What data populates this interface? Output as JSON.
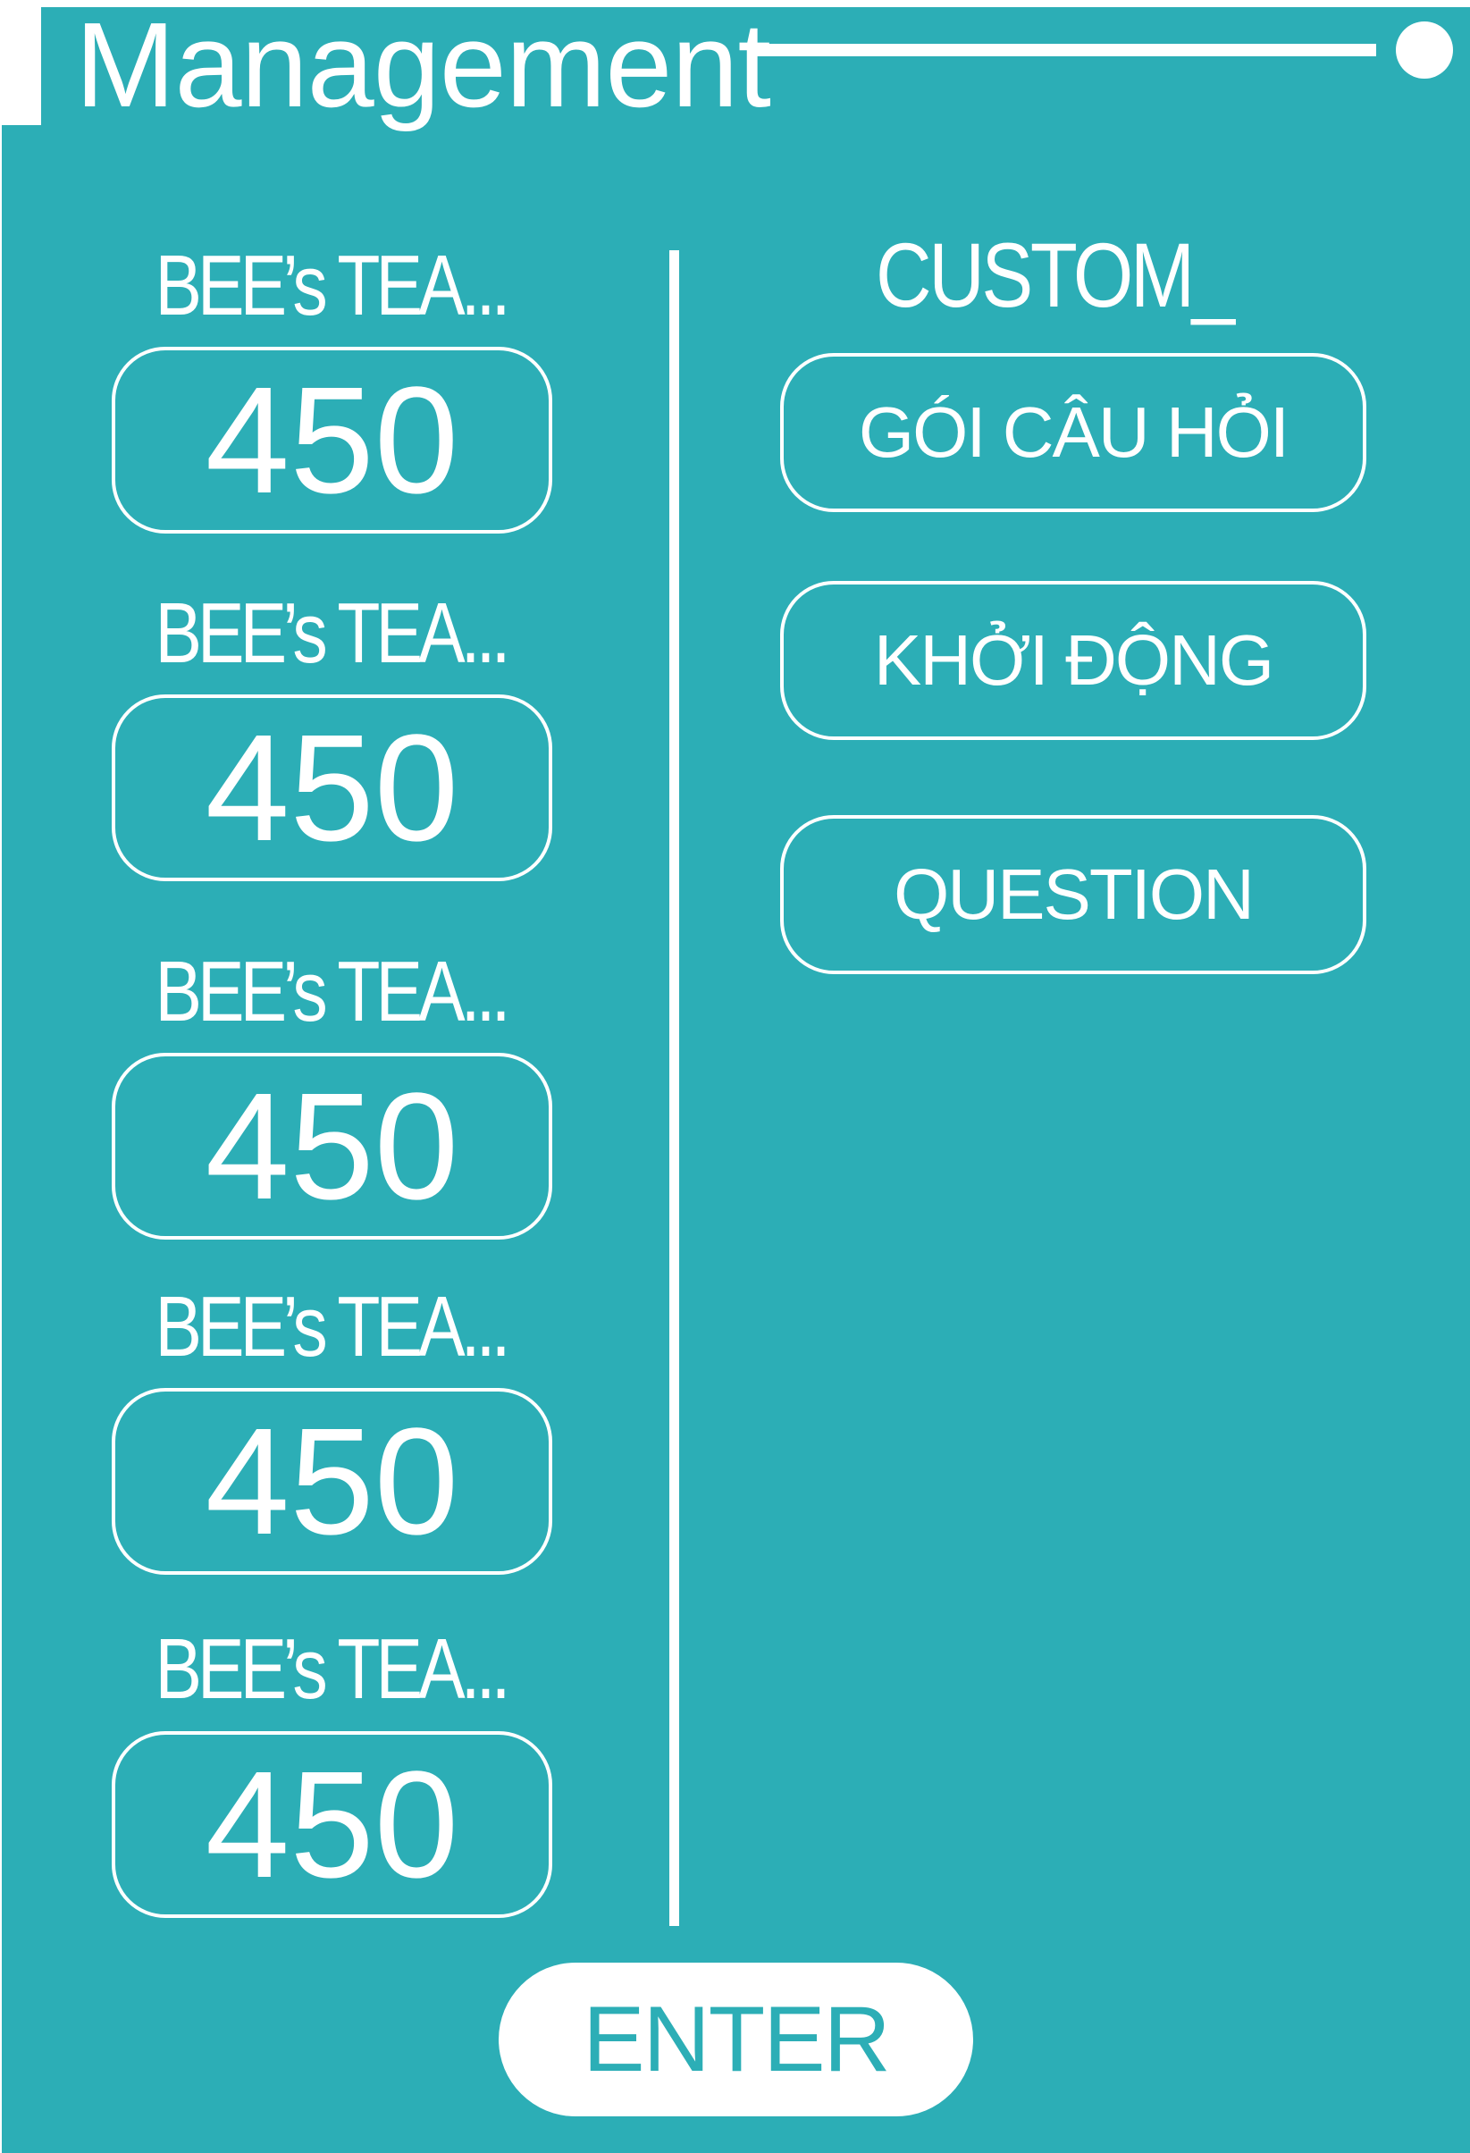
{
  "app": {
    "title": "Management"
  },
  "colors": {
    "panel": "#2caeb6",
    "foreground": "#ffffff"
  },
  "items": [
    {
      "label": "BEE’s TEA...",
      "value": "450"
    },
    {
      "label": "BEE’s TEA...",
      "value": "450"
    },
    {
      "label": "BEE’s TEA...",
      "value": "450"
    },
    {
      "label": "BEE’s TEA...",
      "value": "450"
    },
    {
      "label": "BEE’s TEA...",
      "value": "450"
    }
  ],
  "custom": {
    "title": "CUSTOM_",
    "buttons": [
      {
        "label": "GÓI CÂU HỎI"
      },
      {
        "label": "KHỞI ĐỘNG"
      },
      {
        "label": "QUESTION"
      }
    ]
  },
  "footer": {
    "enter_label": "ENTER"
  }
}
